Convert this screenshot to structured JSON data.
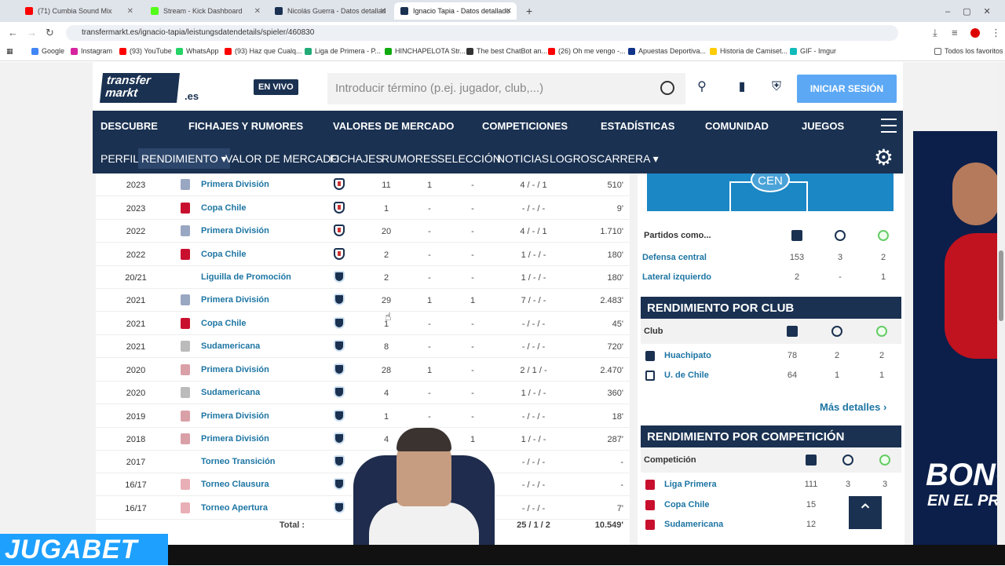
{
  "browser": {
    "tabs": [
      {
        "label": "(71) Cumbia Sound Mix",
        "color": "#ff0000"
      },
      {
        "label": "Stream - Kick Dashboard",
        "color": "#53fc18"
      },
      {
        "label": "Nicolás Guerra - Datos detallad",
        "color": "#1a3151"
      },
      {
        "label": "Ignacio Tapia - Datos detallado",
        "color": "#1a3151"
      }
    ],
    "url": "transfermarkt.es/ignacio-tapia/leistungsdatendetails/spieler/460830",
    "bookmarks": [
      "Google",
      "Instagram",
      "(93) YouTube",
      "WhatsApp",
      "(93) Haz que Cualq...",
      "Liga de Primera - P...",
      "HINCHAPELOTA Str...",
      "The best ChatBot an...",
      "(26) Oh me vengo -...",
      "Apuestas Deportiva...",
      "Historia de Camiset...",
      "GIF - Imgur"
    ],
    "bookmarks_right": "Todos los favoritos"
  },
  "header": {
    "logo": "transfer markt",
    "logo_suffix": ".es",
    "live": "EN VIVO",
    "search_placeholder": "Introducir término (p.ej. jugador, club,...)",
    "login": "INICIAR SESIÓN"
  },
  "main_nav": [
    "DESCUBRE",
    "FICHAJES Y RUMORES",
    "VALORES DE MERCADO",
    "COMPETICIONES",
    "ESTADÍSTICAS",
    "COMUNIDAD",
    "JUEGOS"
  ],
  "sub_nav": [
    "PERFIL",
    "RENDIMIENTO ▾",
    "VALOR DE MERCADO",
    "FICHAJES",
    "RUMORES",
    "SELECCIÓN",
    "NOTICIAS",
    "LOGROS",
    "CARRERA ▾"
  ],
  "table": {
    "rows": [
      {
        "season": "2023",
        "comp": "Primera División",
        "club": "udc",
        "cicon": "#9aa7c2",
        "c1": "11",
        "c2": "1",
        "c3": "-",
        "c4": "4 / - / 1",
        "c5": "510'"
      },
      {
        "season": "2023",
        "comp": "Copa Chile",
        "club": "udc",
        "cicon": "#c8102e",
        "c1": "1",
        "c2": "-",
        "c3": "-",
        "c4": "- / - / -",
        "c5": "9'"
      },
      {
        "season": "2022",
        "comp": "Primera División",
        "club": "udc",
        "cicon": "#9aa7c2",
        "c1": "20",
        "c2": "-",
        "c3": "-",
        "c4": "4 / - / 1",
        "c5": "1.710'"
      },
      {
        "season": "2022",
        "comp": "Copa Chile",
        "club": "udc",
        "cicon": "#c8102e",
        "c1": "2",
        "c2": "-",
        "c3": "-",
        "c4": "1 / - / -",
        "c5": "180'"
      },
      {
        "season": "20/21",
        "comp": "Liguilla de Promoción",
        "club": "hua",
        "cicon": "",
        "c1": "2",
        "c2": "-",
        "c3": "-",
        "c4": "1 / - / -",
        "c5": "180'"
      },
      {
        "season": "2021",
        "comp": "Primera División",
        "club": "hua",
        "cicon": "#9aa7c2",
        "c1": "29",
        "c2": "1",
        "c3": "1",
        "c4": "7 / - / -",
        "c5": "2.483'"
      },
      {
        "season": "2021",
        "comp": "Copa Chile",
        "club": "hua",
        "cicon": "#c8102e",
        "c1": "1",
        "c2": "-",
        "c3": "-",
        "c4": "- / - / -",
        "c5": "45'"
      },
      {
        "season": "2021",
        "comp": "Sudamericana",
        "club": "hua",
        "cicon": "#bbbbbb",
        "c1": "8",
        "c2": "-",
        "c3": "-",
        "c4": "- / - / -",
        "c5": "720'"
      },
      {
        "season": "2020",
        "comp": "Primera División",
        "club": "hua",
        "cicon": "#d9a0a8",
        "c1": "28",
        "c2": "1",
        "c3": "-",
        "c4": "2 / 1 / -",
        "c5": "2.470'"
      },
      {
        "season": "2020",
        "comp": "Sudamericana",
        "club": "hua",
        "cicon": "#bbbbbb",
        "c1": "4",
        "c2": "-",
        "c3": "-",
        "c4": "1 / - / -",
        "c5": "360'"
      },
      {
        "season": "2019",
        "comp": "Primera División",
        "club": "hua",
        "cicon": "#d9a0a8",
        "c1": "1",
        "c2": "-",
        "c3": "-",
        "c4": "- / - / -",
        "c5": "18'"
      },
      {
        "season": "2018",
        "comp": "Primera División",
        "club": "hua",
        "cicon": "#d9a0a8",
        "c1": "4",
        "c2": "-",
        "c3": "1",
        "c4": "1 / - / -",
        "c5": "287'"
      },
      {
        "season": "2017",
        "comp": "Torneo Transición",
        "club": "hua",
        "cicon": "",
        "c1": "-",
        "c2": "-",
        "c3": "-",
        "c4": "- / - / -",
        "c5": "-"
      },
      {
        "season": "16/17",
        "comp": "Torneo Clausura",
        "club": "hua",
        "cicon": "#e8b0b6",
        "c1": "-",
        "c2": "-",
        "c3": "-",
        "c4": "- / - / -",
        "c5": "-"
      },
      {
        "season": "16/17",
        "comp": "Torneo Apertura",
        "club": "hua",
        "cicon": "#e8b0b6",
        "c1": "-",
        "c2": "-",
        "c3": "-",
        "c4": "- / - / -",
        "c5": "7'"
      }
    ],
    "total_label": "Total :",
    "total_cards": "25 / 1 / 2",
    "total_minutes": "10.549'"
  },
  "sidebar": {
    "pitch_label": "CEN",
    "positions_header": "Partidos como...",
    "positions": [
      {
        "name": "Defensa central",
        "a": "153",
        "b": "3",
        "c": "2"
      },
      {
        "name": "Lateral izquierdo",
        "a": "2",
        "b": "-",
        "c": "1"
      }
    ],
    "club_title": "RENDIMIENTO POR CLUB",
    "club_header": "Club",
    "clubs": [
      {
        "name": "Huachipato",
        "a": "78",
        "b": "2",
        "c": "2"
      },
      {
        "name": "U. de Chile",
        "a": "64",
        "b": "1",
        "c": "1"
      }
    ],
    "more": "Más detalles",
    "comp_title": "RENDIMIENTO POR COMPETICIÓN",
    "comp_header": "Competición",
    "comps": [
      {
        "name": "Liga Primera",
        "a": "111",
        "b": "3",
        "c": "3",
        "color": "#c8102e"
      },
      {
        "name": "Copa Chile",
        "a": "15",
        "b": "-",
        "c": "-",
        "color": "#c8102e"
      },
      {
        "name": "Sudamericana",
        "a": "12",
        "b": "-",
        "c": "-",
        "color": "#c8102e"
      }
    ]
  },
  "ad": {
    "line1": "BONO",
    "line2": "EN EL PR"
  },
  "overlay": {
    "brand": "JUGABET"
  }
}
